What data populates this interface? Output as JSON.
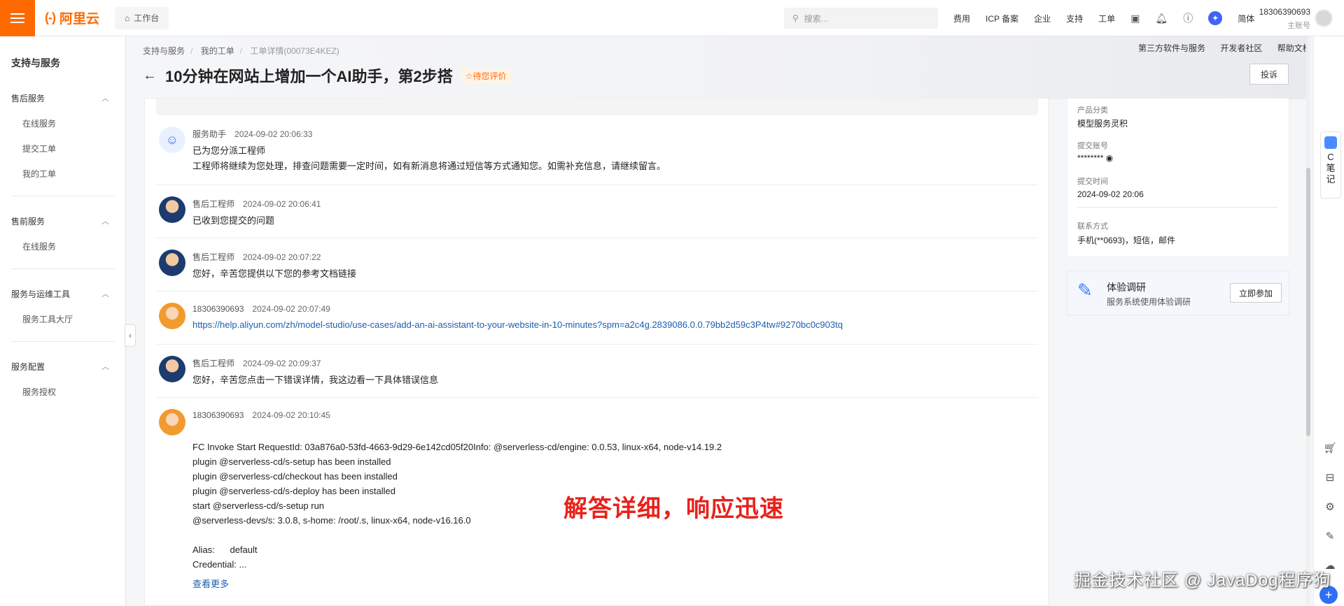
{
  "topbar": {
    "brand": "阿里云",
    "brand_mark": "(-)",
    "workbench": "工作台",
    "search_placeholder": "搜索...",
    "links": [
      "费用",
      "ICP 备案",
      "企业",
      "支持",
      "工单"
    ],
    "lang": "简体",
    "account": "18306390693",
    "role": "主账号",
    "accent": "#ff6a00"
  },
  "sidebar": {
    "title": "支持与服务",
    "groups": [
      {
        "label": "售后服务",
        "items": [
          "在线服务",
          "提交工单",
          "我的工单"
        ]
      },
      {
        "label": "售前服务",
        "items": [
          "在线服务"
        ]
      },
      {
        "label": "服务与运维工具",
        "items": [
          "服务工具大厅"
        ]
      },
      {
        "label": "服务配置",
        "items": [
          "服务授权"
        ]
      }
    ]
  },
  "header": {
    "breadcrumb": [
      "支持与服务",
      "我的工单",
      "工单详情(00073E4KEZ)"
    ],
    "title": "10分钟在网站上增加一个AI助手，第2步搭",
    "badge": "待您评价",
    "links": [
      "第三方软件与服务",
      "开发者社区",
      "帮助文档"
    ],
    "complain": "投诉"
  },
  "messages": [
    {
      "author": "服务助手",
      "time": "2024-09-02 20:06:33",
      "lines": [
        "已为您分派工程师",
        "工程师将继续为您处理，排查问题需要一定时间，如有新消息将通过短信等方式通知您。如需补充信息，请继续留言。"
      ]
    },
    {
      "author": "售后工程师",
      "time": "2024-09-02 20:06:41",
      "lines": [
        "已收到您提交的问题"
      ]
    },
    {
      "author": "售后工程师",
      "time": "2024-09-02 20:07:22",
      "lines": [
        "您好，辛苦您提供以下您的参考文档链接"
      ]
    },
    {
      "author": "18306390693",
      "time": "2024-09-02 20:07:49",
      "lines": [
        "https://help.aliyun.com/zh/model-studio/use-cases/add-an-ai-assistant-to-your-website-in-10-minutes?spm=a2c4g.2839086.0.0.79bb2d59c3P4tw#9270bc0c903tq"
      ]
    },
    {
      "author": "售后工程师",
      "time": "2024-09-02 20:09:37",
      "lines": [
        "您好，辛苦您点击一下错误详情，我这边看一下具体错误信息"
      ]
    },
    {
      "author": "18306390693",
      "time": "2024-09-02 20:10:45",
      "lines": [
        "FC Invoke Start RequestId: 03a876a0-53fd-4663-9d29-6e142cd05f20Info: @serverless-cd/engine: 0.0.53, linux-x64, node-v14.19.2",
        "plugin @serverless-cd/s-setup has been installed",
        "plugin @serverless-cd/checkout has been installed",
        "plugin @serverless-cd/s-deploy has been installed",
        "start @serverless-cd/s-setup run",
        "@serverless-devs/s: 3.0.8, s-home: /root/.s, linux-x64, node-v16.16.0",
        "",
        "Alias:      default",
        "Credential: ..."
      ],
      "more": "查看更多"
    }
  ],
  "overlay": "解答详细，响应迅速",
  "info": {
    "product_label": "产品分类",
    "product_value": "模型服务灵积",
    "account_label": "提交账号",
    "account_value": "********",
    "time_label": "提交时间",
    "time_value": "2024-09-02 20:06",
    "contact_label": "联系方式",
    "contact_value": "手机(**0693)，短信，邮件"
  },
  "survey": {
    "title": "体验调研",
    "subtitle": "服务系统使用体验调研",
    "button": "立即参加"
  },
  "notes_tab": [
    "C",
    "笔",
    "记"
  ],
  "watermark": "掘金技术社区 @ JavaDog程序狗"
}
